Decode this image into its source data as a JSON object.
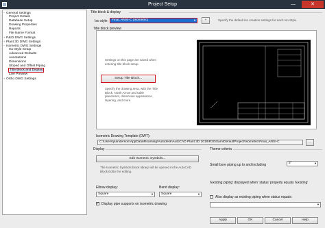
{
  "window": {
    "title": "Project Setup",
    "minimize": "—",
    "close": "✕"
  },
  "tree": [
    {
      "label": "General Settings",
      "level": 0,
      "exp": "−"
    },
    {
      "label": "Project Details",
      "level": 1
    },
    {
      "label": "Database Setup",
      "level": 1
    },
    {
      "label": "Drawing Properties",
      "level": 1
    },
    {
      "label": "Reports",
      "level": 1
    },
    {
      "label": "File Name Format",
      "level": 1
    },
    {
      "label": "P&ID DWG Settings",
      "level": 0,
      "exp": "+"
    },
    {
      "label": "Plant 3D DWG Settings",
      "level": 0,
      "exp": "+"
    },
    {
      "label": "Isometric DWG Settings",
      "level": 0,
      "exp": "−"
    },
    {
      "label": "Iso Style Setup",
      "level": 1
    },
    {
      "label": "Advanced Defaults",
      "level": 1
    },
    {
      "label": "Annotations",
      "level": 1
    },
    {
      "label": "Dimensions",
      "level": 1
    },
    {
      "label": "Sloped and Offset Piping",
      "level": 1
    },
    {
      "label": "Title Block and Display",
      "level": 1,
      "selected": true
    },
    {
      "label": "Live Preview",
      "level": 1
    },
    {
      "label": "Ortho DWG Settings",
      "level": 0,
      "exp": "+"
    }
  ],
  "content": {
    "section": "Title block & display",
    "iso_style_label": "Iso style:",
    "iso_style_value": "Final_ANSI-C (Isometric)",
    "add_btn": "+",
    "style_hint": "Specify the default iso creation settings for each Iso Style.",
    "preview_label": "Title block preview",
    "preview_note": "Settings on this page are saved when entering title block setup.",
    "setup_btn": "Setup Title Block...",
    "setup_desc": "Specify the drawing area, with the Title Block, North Arrow and table placement, dimension appearance, layering, and more.",
    "template_label": "Isometric Drawing Template (DWT):",
    "template_path": "C:\\Users\\jsanderson\\AppData\\Roaming\\Autodesk\\AutoCAD Plant 3D 2019\\R20\\Sam\\DefaultProject\\Isometric\\Final_ANSI-C",
    "browse": "...",
    "display_label": "Display",
    "edit_symbols_btn": "Edit Isometric Symbols...",
    "symbols_desc": "The Isometric Symbols block library will be opened in the AutoCAD Block Editor for editing.",
    "elbow_label": "Elbow display:",
    "elbow_value": "Square",
    "band_label": "Band display:",
    "band_value": "Square",
    "pipe_supports_label": "Display pipe supports on isometric drawing",
    "theme_label": "Theme criteria",
    "small_bore_label": "Small bore piping up to and including",
    "small_bore_value": "2\"",
    "existing_text": "'Existing piping' displayed when 'status' property equals 'Existing'",
    "also_existing_label": "Also display as existing piping when status equals:"
  },
  "footer": {
    "apply": "Apply",
    "ok": "OK",
    "cancel": "Cancel",
    "help": "Help"
  },
  "colors": {
    "titlebar": "#29333f",
    "highlight": "#d10f1b",
    "selection": "#1a6fd1"
  }
}
